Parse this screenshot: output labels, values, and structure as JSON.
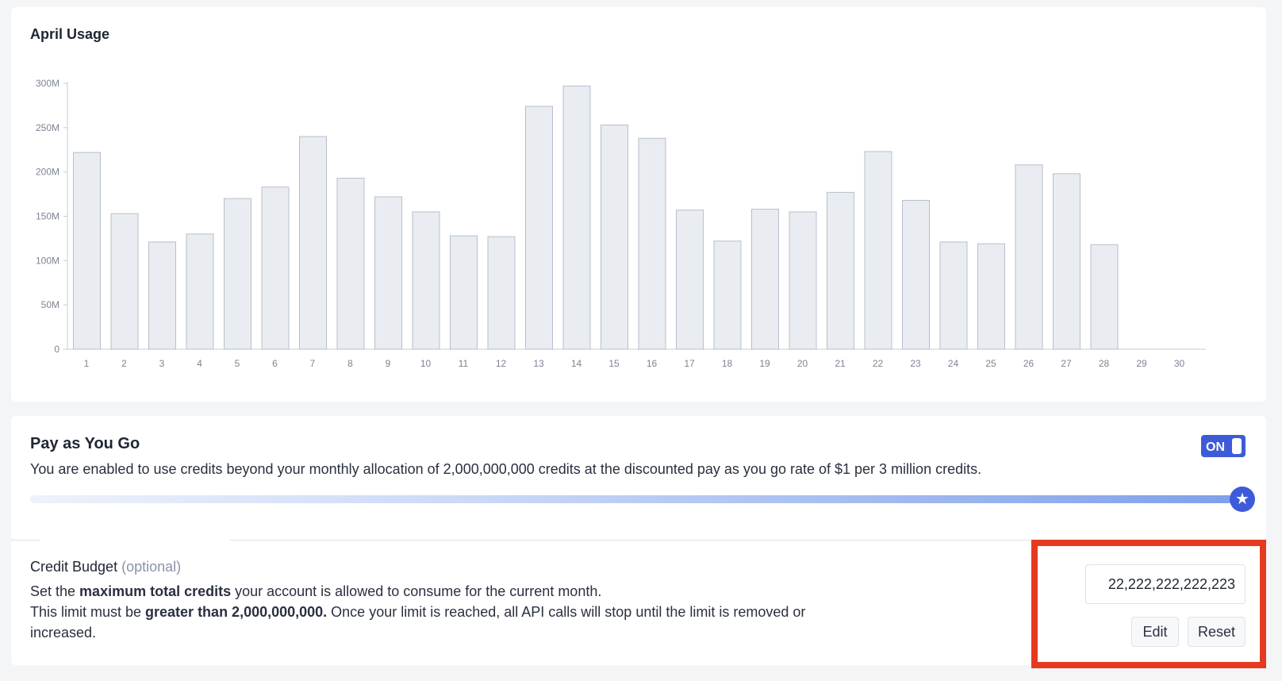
{
  "usage": {
    "title": "April Usage"
  },
  "chart_data": {
    "type": "bar",
    "title": "April Usage",
    "categories": [
      "1",
      "2",
      "3",
      "4",
      "5",
      "6",
      "7",
      "8",
      "9",
      "10",
      "11",
      "12",
      "13",
      "14",
      "15",
      "16",
      "17",
      "18",
      "19",
      "20",
      "21",
      "22",
      "23",
      "24",
      "25",
      "26",
      "27",
      "28",
      "29",
      "30"
    ],
    "values": [
      222,
      153,
      121,
      130,
      170,
      183,
      240,
      193,
      172,
      155,
      128,
      127,
      274,
      297,
      253,
      238,
      157,
      122,
      158,
      155,
      177,
      223,
      168,
      121,
      119,
      208,
      198,
      118,
      0,
      0
    ],
    "unit": "M",
    "ylim": [
      0,
      300
    ],
    "yticks": [
      "0",
      "50M",
      "100M",
      "150M",
      "200M",
      "250M",
      "300M"
    ],
    "grid": false,
    "colors": {
      "bar_fill": "#e9ecf1",
      "bar_stroke": "#b7bfcc"
    }
  },
  "payg": {
    "title": "Pay as You Go",
    "description": "You are enabled to use credits beyond your monthly allocation of 2,000,000,000 credits at the discounted pay as you go rate of $1 per 3 million credits.",
    "toggle_label": "ON",
    "slider_level": 1.0,
    "slider_icon": "star-icon"
  },
  "budget": {
    "title": "Credit Budget",
    "optional": "(optional)",
    "line1_prefix": "Set the ",
    "line1_bold": "maximum total credits",
    "line1_suffix": " your account is allowed to consume for the current month.",
    "line2_prefix": "This limit must be ",
    "line2_bold": "greater than 2,000,000,000.",
    "line2_suffix": " Once your limit is reached, all API calls will stop until the limit is removed or increased.",
    "value": "22,222,222,222,223",
    "edit_label": "Edit",
    "reset_label": "Reset"
  },
  "colors": {
    "accent": "#3d5bd9",
    "highlight": "#e53a1f"
  }
}
